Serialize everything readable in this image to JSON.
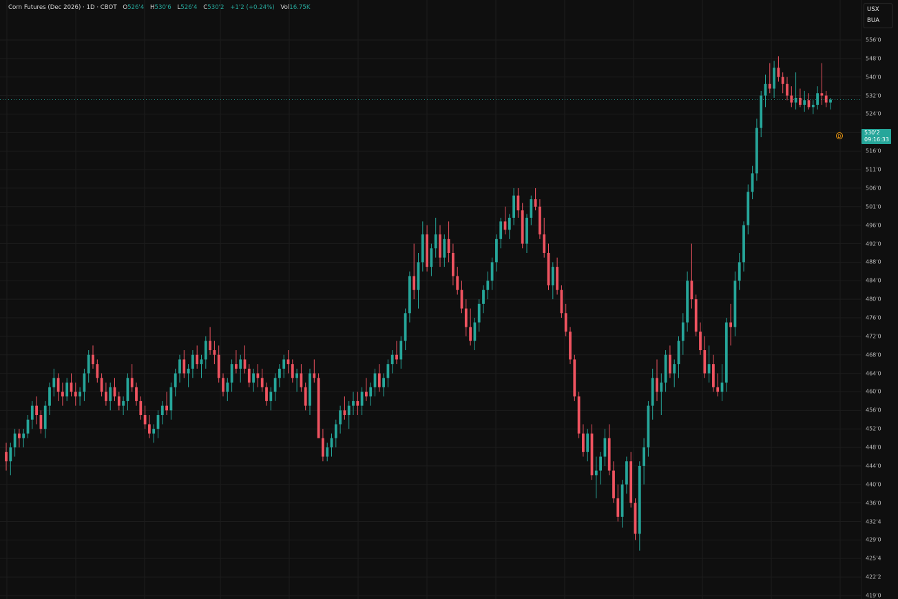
{
  "legend": {
    "symbol": "Corn Futures (Dec 2026) · 1D · CBOT",
    "o_label": "O",
    "o_value": "526'4",
    "h_label": "H",
    "h_value": "530'6",
    "l_label": "L",
    "l_value": "526'4",
    "c_label": "C",
    "c_value": "530'2",
    "change": "+1'2 (+0.24%)",
    "vol_label": "Vol",
    "vol_value": "16.75K"
  },
  "buttons": {
    "currency": "USX",
    "unit": "BUA"
  },
  "price_tag": {
    "price": "530'2",
    "countdown": "09:16:33"
  },
  "badge": {
    "letter": "D"
  },
  "colors": {
    "up": "#26a69a",
    "down": "#ef5360",
    "background": "#0f0f0f",
    "grid": "#1c1c1c",
    "text": "#b8b8b8"
  },
  "chart_data": {
    "type": "candlestick",
    "ylim": [
      419,
      556
    ],
    "yticks": [
      {
        "v": 556,
        "label": "556'0"
      },
      {
        "v": 548,
        "label": "548'0"
      },
      {
        "v": 540,
        "label": "540'0"
      },
      {
        "v": 532,
        "label": "532'0"
      },
      {
        "v": 524,
        "label": "524'0"
      },
      {
        "v": 520,
        "label": "520'0"
      },
      {
        "v": 516,
        "label": "516'0"
      },
      {
        "v": 511,
        "label": "511'0"
      },
      {
        "v": 506,
        "label": "506'0"
      },
      {
        "v": 501,
        "label": "501'0"
      },
      {
        "v": 496,
        "label": "496'0"
      },
      {
        "v": 492,
        "label": "492'0"
      },
      {
        "v": 488,
        "label": "488'0"
      },
      {
        "v": 484,
        "label": "484'0"
      },
      {
        "v": 480,
        "label": "480'0"
      },
      {
        "v": 476,
        "label": "476'0"
      },
      {
        "v": 472,
        "label": "472'0"
      },
      {
        "v": 468,
        "label": "468'0"
      },
      {
        "v": 464,
        "label": "464'0"
      },
      {
        "v": 460,
        "label": "460'0"
      },
      {
        "v": 456,
        "label": "456'0"
      },
      {
        "v": 452,
        "label": "452'0"
      },
      {
        "v": 448,
        "label": "448'0"
      },
      {
        "v": 444,
        "label": "444'0"
      },
      {
        "v": 440,
        "label": "440'0"
      },
      {
        "v": 436,
        "label": "436'0"
      },
      {
        "v": 432,
        "label": "432'4"
      },
      {
        "v": 429,
        "label": "429'0"
      },
      {
        "v": 425.5,
        "label": "425'4"
      },
      {
        "v": 422.25,
        "label": "422'2"
      },
      {
        "v": 419,
        "label": "419'0"
      }
    ],
    "last_price": 530.25,
    "ohlc": [
      [
        447,
        449,
        443,
        445
      ],
      [
        445,
        449,
        442,
        448
      ],
      [
        448,
        452,
        446,
        451
      ],
      [
        451,
        452,
        448,
        450
      ],
      [
        450,
        452,
        448,
        451
      ],
      [
        451,
        455,
        450,
        454
      ],
      [
        454,
        458,
        452,
        457
      ],
      [
        457,
        459,
        453,
        455
      ],
      [
        455,
        456,
        451,
        452
      ],
      [
        452,
        458,
        450,
        457
      ],
      [
        457,
        462,
        455,
        461
      ],
      [
        461,
        465,
        459,
        463
      ],
      [
        463,
        464,
        458,
        460
      ],
      [
        460,
        462,
        457,
        459
      ],
      [
        459,
        463,
        458,
        462
      ],
      [
        462,
        464,
        459,
        460
      ],
      [
        460,
        462,
        457,
        459
      ],
      [
        459,
        461,
        457,
        460
      ],
      [
        460,
        465,
        458,
        464
      ],
      [
        464,
        469,
        462,
        468
      ],
      [
        468,
        470,
        465,
        466
      ],
      [
        466,
        467,
        462,
        463
      ],
      [
        463,
        464,
        459,
        460
      ],
      [
        460,
        462,
        457,
        458
      ],
      [
        458,
        462,
        456,
        461
      ],
      [
        461,
        463,
        458,
        459
      ],
      [
        459,
        460,
        456,
        457
      ],
      [
        457,
        459,
        455,
        458
      ],
      [
        458,
        464,
        456,
        463
      ],
      [
        463,
        466,
        460,
        461
      ],
      [
        461,
        462,
        457,
        458
      ],
      [
        458,
        459,
        454,
        455
      ],
      [
        455,
        457,
        452,
        453
      ],
      [
        453,
        455,
        450,
        451
      ],
      [
        451,
        453,
        449,
        452
      ],
      [
        452,
        456,
        450,
        455
      ],
      [
        455,
        458,
        453,
        457
      ],
      [
        457,
        460,
        455,
        456
      ],
      [
        456,
        462,
        454,
        461
      ],
      [
        461,
        465,
        459,
        464
      ],
      [
        464,
        468,
        462,
        467
      ],
      [
        467,
        469,
        463,
        464
      ],
      [
        464,
        466,
        461,
        465
      ],
      [
        465,
        469,
        463,
        468
      ],
      [
        468,
        470,
        465,
        466
      ],
      [
        466,
        468,
        463,
        467
      ],
      [
        467,
        472,
        465,
        471
      ],
      [
        471,
        474,
        468,
        469
      ],
      [
        469,
        471,
        466,
        468
      ],
      [
        468,
        470,
        462,
        463
      ],
      [
        463,
        464,
        459,
        460
      ],
      [
        460,
        463,
        458,
        462
      ],
      [
        462,
        467,
        460,
        466
      ],
      [
        466,
        469,
        464,
        465
      ],
      [
        465,
        468,
        462,
        467
      ],
      [
        467,
        470,
        464,
        465
      ],
      [
        465,
        466,
        461,
        462
      ],
      [
        462,
        465,
        460,
        464
      ],
      [
        464,
        466,
        461,
        463
      ],
      [
        463,
        465,
        460,
        461
      ],
      [
        461,
        462,
        457,
        458
      ],
      [
        458,
        461,
        456,
        460
      ],
      [
        460,
        464,
        458,
        463
      ],
      [
        463,
        466,
        461,
        465
      ],
      [
        465,
        468,
        463,
        467
      ],
      [
        467,
        469,
        464,
        466
      ],
      [
        466,
        467,
        462,
        463
      ],
      [
        463,
        465,
        460,
        464
      ],
      [
        464,
        466,
        460,
        461
      ],
      [
        461,
        462,
        456,
        457
      ],
      [
        457,
        465,
        455,
        464
      ],
      [
        464,
        467,
        462,
        463
      ],
      [
        463,
        464,
        458,
        450
      ],
      [
        450,
        452,
        445,
        446
      ],
      [
        446,
        449,
        445,
        448
      ],
      [
        448,
        451,
        446,
        450
      ],
      [
        450,
        454,
        448,
        453
      ],
      [
        453,
        457,
        451,
        456
      ],
      [
        456,
        459,
        454,
        455
      ],
      [
        455,
        458,
        452,
        457
      ],
      [
        457,
        460,
        455,
        458
      ],
      [
        458,
        460,
        455,
        457
      ],
      [
        457,
        461,
        455,
        460
      ],
      [
        460,
        463,
        458,
        459
      ],
      [
        459,
        462,
        457,
        461
      ],
      [
        461,
        465,
        459,
        464
      ],
      [
        464,
        466,
        460,
        461
      ],
      [
        461,
        464,
        459,
        463
      ],
      [
        463,
        467,
        461,
        466
      ],
      [
        466,
        469,
        464,
        468
      ],
      [
        468,
        471,
        466,
        467
      ],
      [
        467,
        472,
        465,
        471
      ],
      [
        471,
        478,
        469,
        477
      ],
      [
        477,
        486,
        475,
        485
      ],
      [
        485,
        492,
        480,
        482
      ],
      [
        482,
        490,
        478,
        488
      ],
      [
        488,
        497,
        486,
        494
      ],
      [
        494,
        496,
        486,
        487
      ],
      [
        487,
        492,
        485,
        491
      ],
      [
        491,
        498,
        489,
        494
      ],
      [
        494,
        496,
        487,
        489
      ],
      [
        489,
        494,
        487,
        493
      ],
      [
        493,
        497,
        488,
        490
      ],
      [
        490,
        492,
        483,
        485
      ],
      [
        485,
        487,
        481,
        482
      ],
      [
        482,
        484,
        477,
        478
      ],
      [
        478,
        480,
        472,
        474
      ],
      [
        474,
        478,
        470,
        471
      ],
      [
        471,
        476,
        469,
        475
      ],
      [
        475,
        480,
        473,
        479
      ],
      [
        479,
        483,
        477,
        482
      ],
      [
        482,
        486,
        480,
        484
      ],
      [
        484,
        489,
        482,
        488
      ],
      [
        488,
        494,
        486,
        493
      ],
      [
        493,
        498,
        491,
        497
      ],
      [
        497,
        501,
        494,
        495
      ],
      [
        495,
        499,
        493,
        498
      ],
      [
        498,
        506,
        496,
        504
      ],
      [
        504,
        506,
        498,
        500
      ],
      [
        500,
        502,
        491,
        492
      ],
      [
        492,
        499,
        490,
        498
      ],
      [
        498,
        504,
        496,
        503
      ],
      [
        503,
        506,
        500,
        501
      ],
      [
        501,
        503,
        493,
        494
      ],
      [
        494,
        498,
        489,
        490
      ],
      [
        490,
        492,
        482,
        483
      ],
      [
        483,
        488,
        480,
        487
      ],
      [
        487,
        489,
        481,
        482
      ],
      [
        482,
        483,
        476,
        477
      ],
      [
        477,
        479,
        472,
        473
      ],
      [
        473,
        474,
        466,
        467
      ],
      [
        467,
        468,
        458,
        459
      ],
      [
        459,
        460,
        450,
        451
      ],
      [
        451,
        453,
        446,
        447
      ],
      [
        447,
        452,
        445,
        451
      ],
      [
        451,
        453,
        441,
        442
      ],
      [
        442,
        446,
        437,
        443
      ],
      [
        443,
        447,
        440,
        446
      ],
      [
        446,
        452,
        444,
        450
      ],
      [
        450,
        453,
        442,
        443
      ],
      [
        443,
        445,
        436,
        437
      ],
      [
        437,
        440,
        432,
        433
      ],
      [
        433,
        441,
        431,
        440
      ],
      [
        440,
        446,
        438,
        445
      ],
      [
        445,
        447,
        435,
        436
      ],
      [
        436,
        437,
        429,
        430
      ],
      [
        430,
        445,
        427,
        444
      ],
      [
        444,
        450,
        440,
        448
      ],
      [
        448,
        458,
        446,
        457
      ],
      [
        457,
        465,
        454,
        463
      ],
      [
        463,
        467,
        458,
        460
      ],
      [
        460,
        464,
        455,
        462
      ],
      [
        462,
        469,
        460,
        468
      ],
      [
        468,
        470,
        463,
        464
      ],
      [
        464,
        467,
        461,
        466
      ],
      [
        466,
        472,
        463,
        471
      ],
      [
        471,
        477,
        468,
        475
      ],
      [
        475,
        486,
        473,
        484
      ],
      [
        484,
        492,
        478,
        480
      ],
      [
        480,
        481,
        472,
        473
      ],
      [
        473,
        475,
        468,
        469
      ],
      [
        469,
        472,
        463,
        464
      ],
      [
        464,
        470,
        462,
        466
      ],
      [
        466,
        468,
        460,
        461
      ],
      [
        461,
        464,
        459,
        460
      ],
      [
        460,
        466,
        458,
        462
      ],
      [
        462,
        476,
        460,
        475
      ],
      [
        475,
        479,
        470,
        474
      ],
      [
        474,
        486,
        472,
        484
      ],
      [
        484,
        490,
        482,
        488
      ],
      [
        488,
        497,
        486,
        496
      ],
      [
        496,
        507,
        494,
        505
      ],
      [
        505,
        512,
        503,
        510
      ],
      [
        510,
        523,
        508,
        521
      ],
      [
        521,
        534,
        519,
        532
      ],
      [
        532,
        541,
        527,
        537
      ],
      [
        537,
        546,
        533,
        535
      ],
      [
        535,
        547,
        531,
        544
      ],
      [
        544,
        549,
        538,
        540
      ],
      [
        540,
        542,
        533,
        537
      ],
      [
        537,
        540,
        530,
        532
      ],
      [
        532,
        536,
        527,
        529
      ],
      [
        529,
        542,
        526,
        531
      ],
      [
        531,
        535,
        527,
        528
      ],
      [
        528,
        534,
        525,
        530
      ],
      [
        530,
        533,
        526,
        527
      ],
      [
        527,
        530,
        524,
        528
      ],
      [
        528,
        536,
        526,
        533
      ],
      [
        533,
        546,
        528,
        532
      ],
      [
        532,
        534,
        527,
        529
      ],
      [
        529,
        531,
        526,
        530.25
      ]
    ]
  }
}
